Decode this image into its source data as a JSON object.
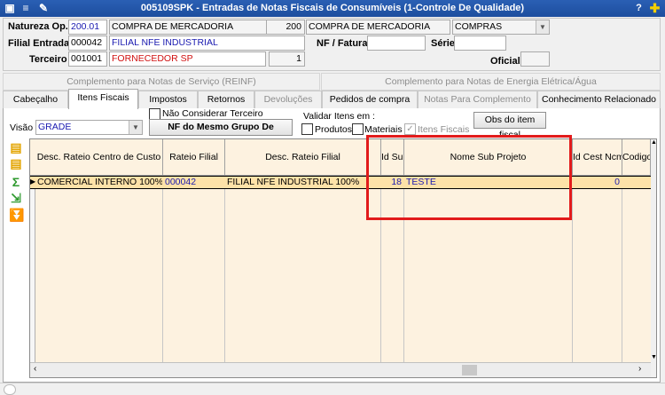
{
  "window": {
    "title": "005109SPK - Entradas de Notas Fiscais de Consumíveis (1-Controle De Qualidade)",
    "help_icon": "help-icon",
    "add_icon": "plus-icon"
  },
  "header": {
    "natureza_label": "Natureza Op.",
    "natureza_code": "200.01",
    "natureza_desc": "COMPRA DE MERCADORIA",
    "natureza_num": "200",
    "natureza_desc2": "COMPRA DE MERCADORIA",
    "natureza_combo": "COMPRAS",
    "filial_label": "Filial Entrada",
    "filial_code": "000042",
    "filial_desc": "FILIAL NFE INDUSTRIAL",
    "nf_label": "NF / Fatura",
    "nf_value": "",
    "serie_label": "Série",
    "serie_value": "",
    "terceiro_label": "Terceiro",
    "terceiro_code": "001001",
    "terceiro_desc": "FORNECEDOR SP",
    "terceiro_num": "1",
    "oficial_label": "Oficial",
    "oficial_value": ""
  },
  "tabs_top": [
    "Complemento para Notas de Serviço (REINF)",
    "Complemento para Notas de Energia Elétrica/Água"
  ],
  "tabs": [
    "Cabeçalho",
    "Itens Fiscais",
    "Impostos",
    "Retornos",
    "Devoluções",
    "Pedidos de compra",
    "Notas Para Complemento",
    "Conhecimento Relacionado"
  ],
  "toolbar": {
    "nao_considerar": "Não Considerar Terceiro",
    "visao_label": "Visão",
    "visao_value": "GRADE",
    "nf_grupo_button": "NF do Mesmo Grupo De Empresa",
    "validar_label": "Validar Itens em :",
    "produtos_label": "Produtos",
    "materiais_label": "Materiais",
    "itens_fiscais_label": "Itens Fiscais",
    "obs_button": "Obs do item fiscal"
  },
  "grid": {
    "columns": [
      "Desc. Rateio Centro de Custo",
      "Rateio Filial",
      "Desc. Rateio Filial",
      "Id Sub",
      "Nome Sub Projeto",
      "Id Cest Ncm",
      "Codigo"
    ],
    "row": {
      "centro_custo": "COMERCIAL INTERNO 100%",
      "rateio_filial": "000042",
      "desc_rateio_filial": "FILIAL NFE INDUSTRIAL 100%",
      "id_sub": "18",
      "nome_sub_projeto": "TESTE",
      "id_cest_ncm": "0",
      "codigo": ""
    }
  },
  "colors": {
    "title_bar": "#1d4e9e",
    "grid_bg": "#fdf2e0",
    "row_selected": "#fde2a8",
    "highlight": "#e21b1b"
  }
}
